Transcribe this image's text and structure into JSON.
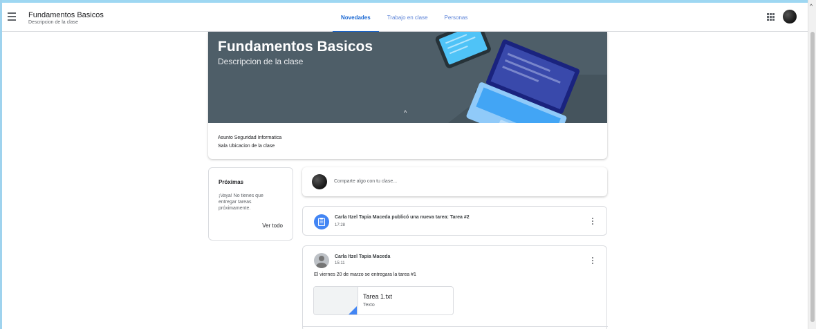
{
  "header": {
    "class_title": "Fundamentos Basicos",
    "class_subtitle": "Descripcion de la clase",
    "tabs": [
      {
        "label": "Novedades",
        "active": true
      },
      {
        "label": "Trabajo en clase",
        "active": false
      },
      {
        "label": "Personas",
        "active": false
      }
    ],
    "icons": [
      "menu-icon",
      "apps-icon",
      "account-avatar"
    ]
  },
  "banner": {
    "title": "Fundamentos Basicos",
    "description": "Descripcion de la clase",
    "background_color": "#4e5e68",
    "subject": "Asunto Seguridad Informatica",
    "room": "Sala Ubicacion de la clase"
  },
  "upcoming": {
    "title": "Próximas",
    "message": "¡Vaya! No tienes que entregar tareas próximamente.",
    "link": "Ver todo"
  },
  "stream": {
    "share_placeholder": "Comparte algo con tu clase...",
    "assignment_post": {
      "title": "Carla Itzel Tapia Maceda publicó una nueva tarea: Tarea #2",
      "time": "17:28"
    },
    "announcement": {
      "author": "Carla Itzel Tapia Maceda",
      "time": "15:11",
      "body": "El viernes 20 de marzo se entregara la tarea #1",
      "attachment": {
        "name": "Tarea 1.txt",
        "type": "Texto"
      }
    }
  },
  "colors": {
    "accent": "#1967d2",
    "assignment_icon": "#4285f4"
  }
}
